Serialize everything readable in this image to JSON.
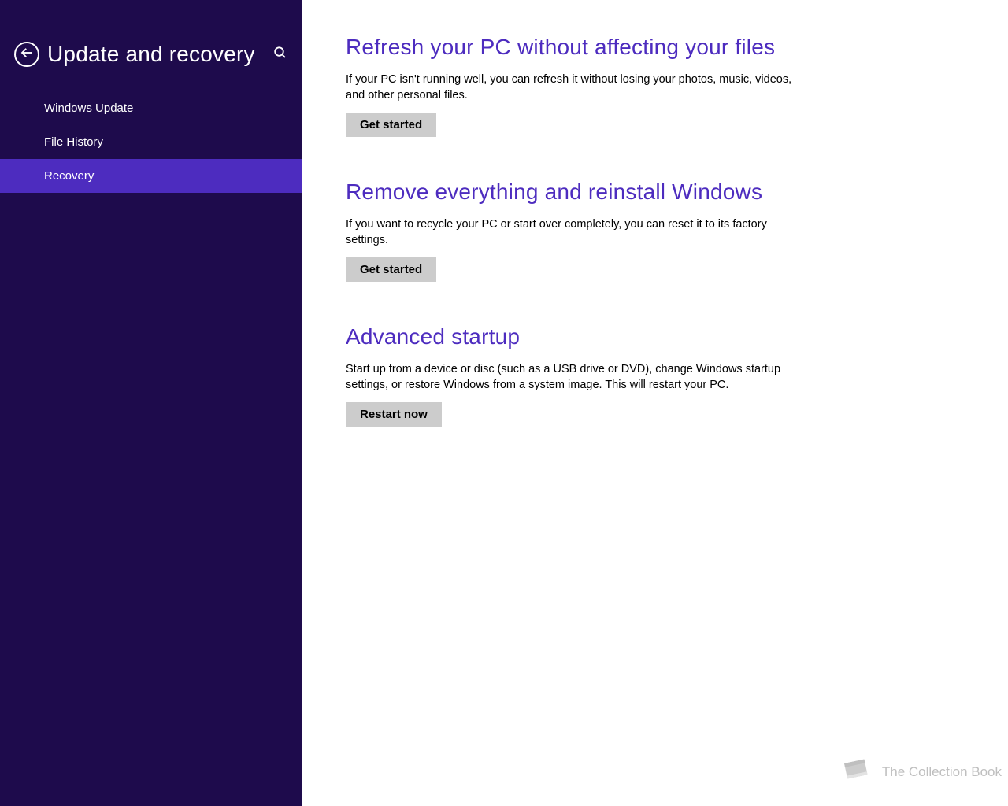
{
  "sidebar": {
    "title": "Update and recovery",
    "items": [
      {
        "label": "Windows Update",
        "active": false
      },
      {
        "label": "File History",
        "active": false
      },
      {
        "label": "Recovery",
        "active": true
      }
    ]
  },
  "main": {
    "sections": [
      {
        "heading": "Refresh your PC without affecting your files",
        "body": "If your PC isn't running well, you can refresh it without losing your photos, music, videos, and other personal files.",
        "button": "Get started"
      },
      {
        "heading": "Remove everything and reinstall Windows",
        "body": "If you want to recycle your PC or start over completely, you can reset it to its factory settings.",
        "button": "Get started"
      },
      {
        "heading": "Advanced startup",
        "body": "Start up from a device or disc (such as a USB drive or DVD), change Windows startup settings, or restore Windows from a system image. This will restart your PC.",
        "button": "Restart now"
      }
    ]
  },
  "watermark": {
    "text": "The Collection Book"
  }
}
